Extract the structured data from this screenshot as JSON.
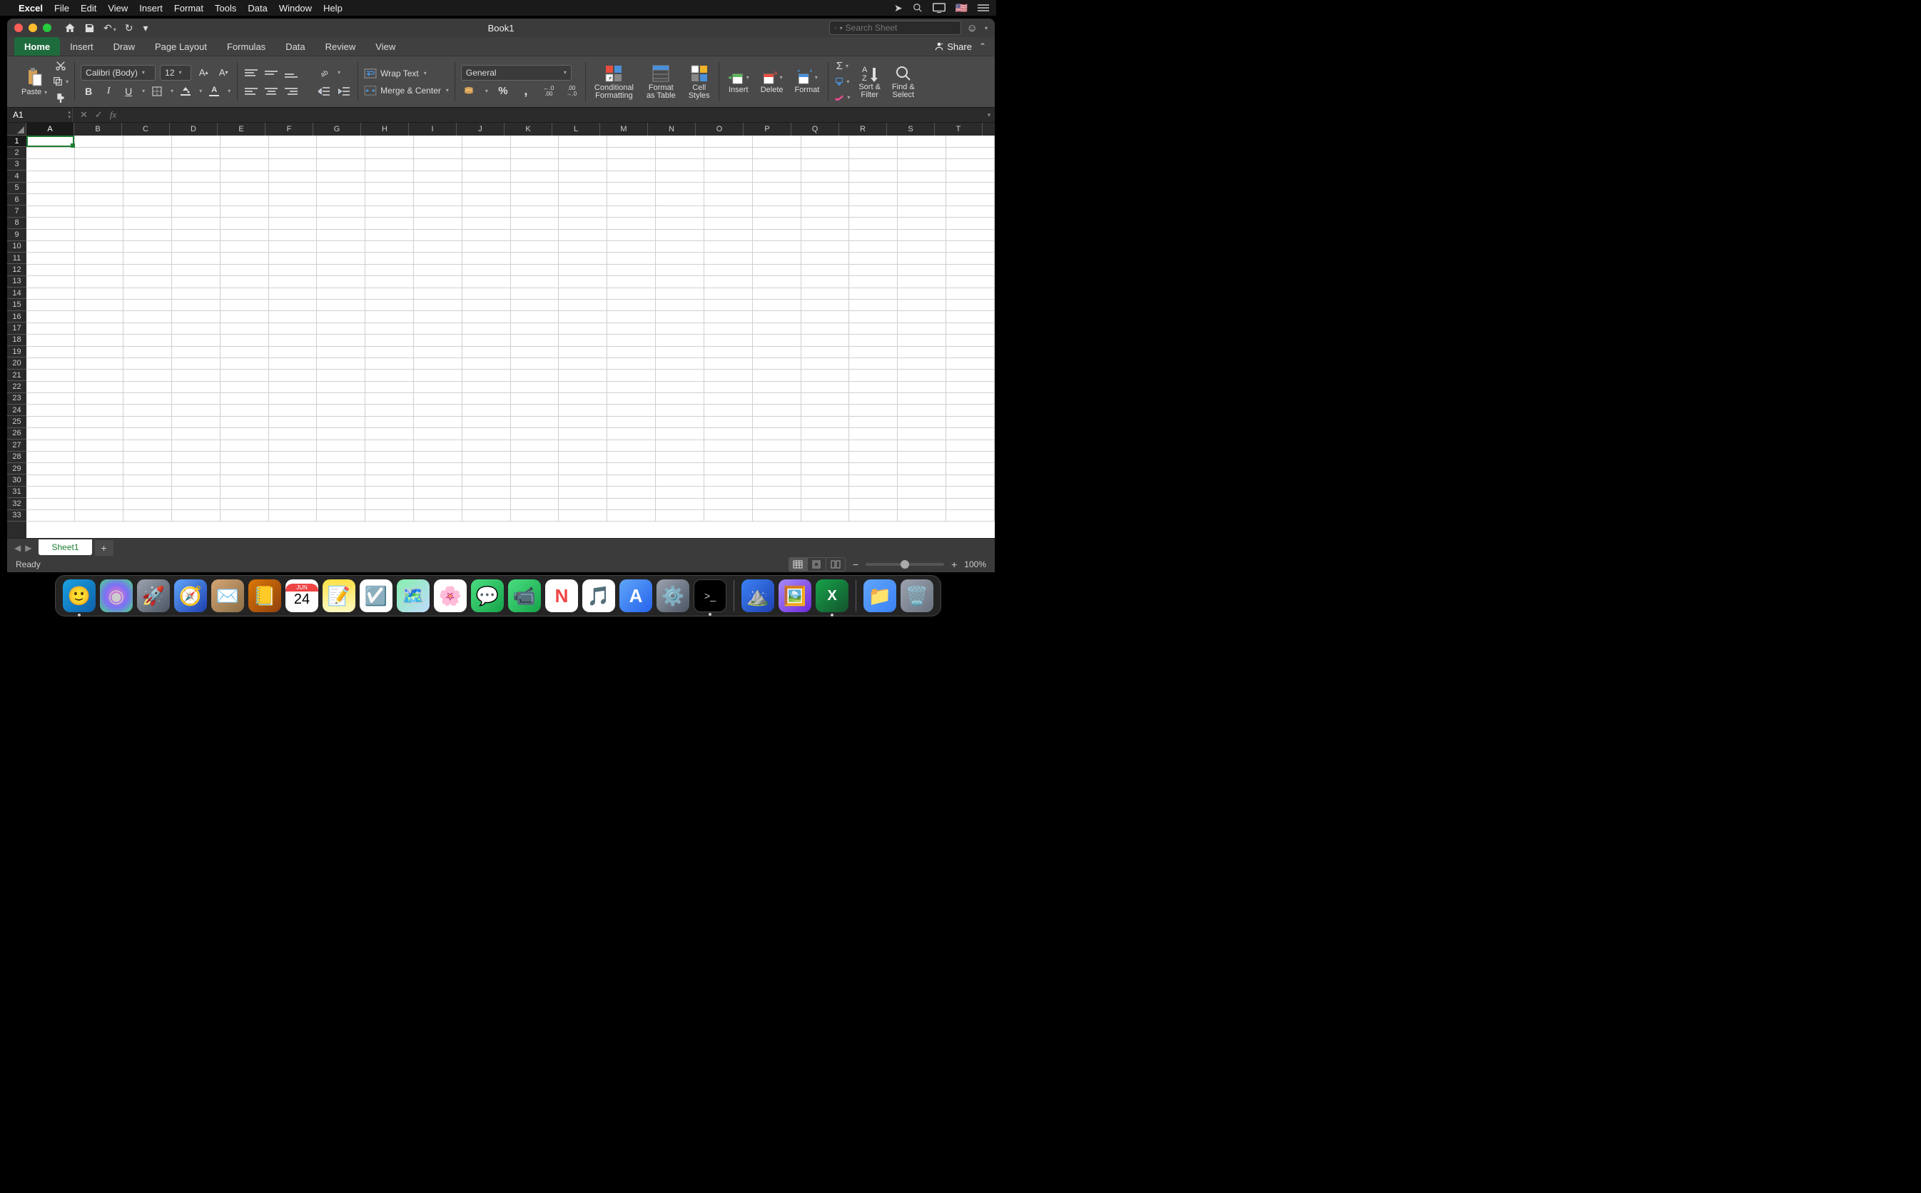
{
  "macos_menubar": {
    "app_name": "Excel",
    "menus": [
      "File",
      "Edit",
      "View",
      "Insert",
      "Format",
      "Tools",
      "Data",
      "Window",
      "Help"
    ]
  },
  "titlebar": {
    "title": "Book1",
    "search_placeholder": "Search Sheet"
  },
  "ribbon_tabs": [
    "Home",
    "Insert",
    "Draw",
    "Page Layout",
    "Formulas",
    "Data",
    "Review",
    "View"
  ],
  "ribbon_active_tab": "Home",
  "share_label": "Share",
  "ribbon": {
    "paste_label": "Paste",
    "font_name": "Calibri (Body)",
    "font_size": "12",
    "wrap_text_label": "Wrap Text",
    "merge_center_label": "Merge & Center",
    "number_format": "General",
    "conditional_formatting_label": "Conditional\nFormatting",
    "format_as_table_label": "Format\nas Table",
    "cell_styles_label": "Cell\nStyles",
    "insert_label": "Insert",
    "delete_label": "Delete",
    "format_label": "Format",
    "sort_filter_label": "Sort &\nFilter",
    "find_select_label": "Find &\nSelect"
  },
  "formula_bar": {
    "name_box": "A1",
    "formula": ""
  },
  "columns": [
    "A",
    "B",
    "C",
    "D",
    "E",
    "F",
    "G",
    "H",
    "I",
    "J",
    "K",
    "L",
    "M",
    "N",
    "O",
    "P",
    "Q",
    "R",
    "S",
    "T"
  ],
  "rows": [
    1,
    2,
    3,
    4,
    5,
    6,
    7,
    8,
    9,
    10,
    11,
    12,
    13,
    14,
    15,
    16,
    17,
    18,
    19,
    20,
    21,
    22,
    23,
    24,
    25,
    26,
    27,
    28,
    29,
    30,
    31,
    32,
    33
  ],
  "active_cell": "A1",
  "sheet_tabs": [
    "Sheet1"
  ],
  "status_bar": {
    "status": "Ready",
    "zoom": "100%"
  },
  "calendar": {
    "month": "JUN",
    "day": "24"
  },
  "dock_apps": [
    "finder",
    "siri",
    "launchpad",
    "safari",
    "mail",
    "contacts",
    "calendar",
    "notes",
    "reminders",
    "maps",
    "photos",
    "messages",
    "facetime",
    "news",
    "music",
    "appstore",
    "sysprefs",
    "terminal"
  ],
  "dock_right": [
    "sketch",
    "preview",
    "excel"
  ],
  "dock_end": [
    "folder",
    "trash"
  ]
}
